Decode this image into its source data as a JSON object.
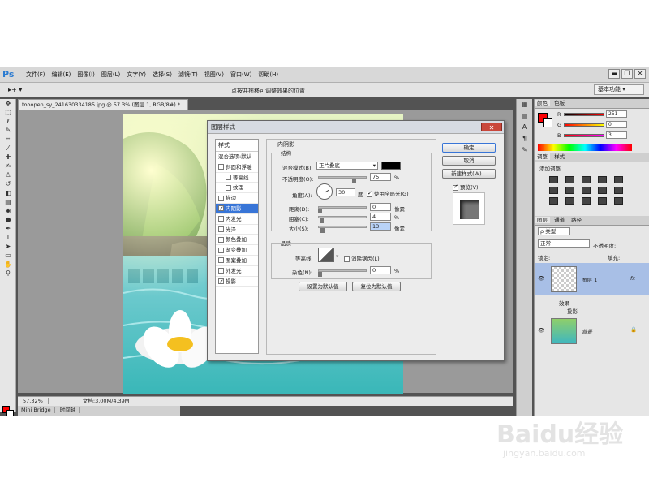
{
  "menubar": {
    "logo": "Ps",
    "items": [
      "文件(F)",
      "编辑(E)",
      "图像(I)",
      "图层(L)",
      "文字(Y)",
      "选择(S)",
      "滤镜(T)",
      "视图(V)",
      "窗口(W)",
      "帮助(H)"
    ],
    "min": "▬",
    "restore": "❐",
    "close": "✕"
  },
  "optionsbar": {
    "hint": "点按并拖移可调整效果的位置",
    "workspace": "基本功能"
  },
  "document": {
    "tab": "tooopen_sy_241630334185.jpg @ 57.3% (图层 1, RGB/8#) *",
    "zoom": "57.32%",
    "doc_size": "文档:3.00M/4.39M"
  },
  "bottom_tabs": [
    "Mini Bridge",
    "时间轴"
  ],
  "color_panel": {
    "tabs": [
      "颜色",
      "色板"
    ],
    "r": "251",
    "g": "0",
    "b": "3",
    "r_label": "R",
    "g_label": "G",
    "b_label": "B"
  },
  "adjust_panel": {
    "tabs": [
      "调整",
      "样式"
    ],
    "title": "添加调整"
  },
  "layers_panel": {
    "tabs": [
      "图层",
      "通道",
      "路径"
    ],
    "kind": "ρ 类型",
    "blend": "正常",
    "opacity_label": "不透明度:",
    "lock_label": "锁定:",
    "fill_label": "填充:",
    "layer1": "图层 1",
    "fx": "fx",
    "effects": "效果",
    "drop_shadow": "投影",
    "background": "背景"
  },
  "dialog": {
    "title": "图层样式",
    "close": "✕",
    "styles_header": "样式",
    "style_items": [
      {
        "label": "混合选项:默认",
        "checkbox": false,
        "checked": false
      },
      {
        "label": "斜面和浮雕",
        "checkbox": true,
        "checked": false
      },
      {
        "label": "等高线",
        "checkbox": true,
        "checked": false
      },
      {
        "label": "纹理",
        "checkbox": true,
        "checked": false
      },
      {
        "label": "描边",
        "checkbox": true,
        "checked": false
      },
      {
        "label": "内阴影",
        "checkbox": true,
        "checked": true
      },
      {
        "label": "内发光",
        "checkbox": true,
        "checked": false
      },
      {
        "label": "光泽",
        "checkbox": true,
        "checked": false
      },
      {
        "label": "颜色叠加",
        "checkbox": true,
        "checked": false
      },
      {
        "label": "渐变叠加",
        "checkbox": true,
        "checked": false
      },
      {
        "label": "图案叠加",
        "checkbox": true,
        "checked": false
      },
      {
        "label": "外发光",
        "checkbox": true,
        "checked": false
      },
      {
        "label": "投影",
        "checkbox": true,
        "checked": true
      }
    ],
    "section_title": "内阴影",
    "structure": "结构",
    "blend_mode_label": "混合模式(B):",
    "blend_mode": "正片叠底",
    "opacity_label": "不透明度(O):",
    "opacity": "75",
    "angle_label": "角度(A):",
    "angle": "30",
    "degree": "度",
    "global_light": "使用全局光(G)",
    "distance_label": "距离(D):",
    "distance": "0",
    "choke_label": "阻塞(C):",
    "choke": "4",
    "size_label": "大小(S):",
    "size": "13",
    "px": "像素",
    "percent": "%",
    "quality": "品质",
    "contour_label": "等高线:",
    "anti_alias": "消除锯齿(L)",
    "noise_label": "杂色(N):",
    "noise": "0",
    "set_default": "设置为默认值",
    "reset_default": "复位为默认值",
    "ok": "确定",
    "cancel": "取消",
    "new_style": "新建样式(W)...",
    "preview": "预览(V)",
    "shadow_color": "#000000"
  },
  "watermark": {
    "brand": "Baidu经验",
    "url": "jingyan.baidu.com"
  }
}
